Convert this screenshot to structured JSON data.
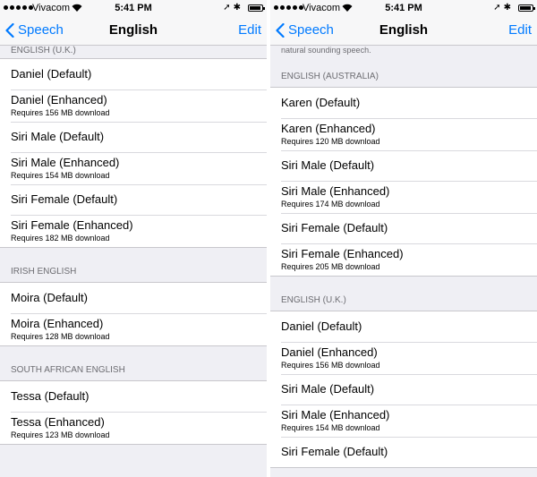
{
  "status": {
    "carrier": "Vivacom",
    "time": "5:41 PM",
    "battery_level": 0.9
  },
  "left": {
    "nav": {
      "back_label": "Speech",
      "title": "English",
      "edit_label": "Edit"
    },
    "sections": [
      {
        "header": "ENGLISH (U.K.)",
        "voices": [
          {
            "name": "Daniel (Default)",
            "detail": ""
          },
          {
            "name": "Daniel (Enhanced)",
            "detail": "Requires 156 MB download"
          },
          {
            "name": "Siri Male (Default)",
            "detail": ""
          },
          {
            "name": "Siri Male (Enhanced)",
            "detail": "Requires 154 MB download"
          },
          {
            "name": "Siri Female (Default)",
            "detail": ""
          },
          {
            "name": "Siri Female (Enhanced)",
            "detail": "Requires 182 MB download"
          }
        ]
      },
      {
        "header": "IRISH ENGLISH",
        "voices": [
          {
            "name": "Moira (Default)",
            "detail": ""
          },
          {
            "name": "Moira (Enhanced)",
            "detail": "Requires 128 MB download"
          }
        ]
      },
      {
        "header": "SOUTH AFRICAN ENGLISH",
        "voices": [
          {
            "name": "Tessa (Default)",
            "detail": ""
          },
          {
            "name": "Tessa (Enhanced)",
            "detail": "Requires 123 MB download"
          }
        ]
      }
    ]
  },
  "right": {
    "nav": {
      "back_label": "Speech",
      "title": "English",
      "edit_label": "Edit"
    },
    "intro_text": "natural sounding speech.",
    "sections": [
      {
        "header": "ENGLISH (AUSTRALIA)",
        "voices": [
          {
            "name": "Karen (Default)",
            "detail": ""
          },
          {
            "name": "Karen (Enhanced)",
            "detail": "Requires 120 MB download"
          },
          {
            "name": "Siri Male (Default)",
            "detail": ""
          },
          {
            "name": "Siri Male (Enhanced)",
            "detail": "Requires 174 MB download"
          },
          {
            "name": "Siri Female (Default)",
            "detail": ""
          },
          {
            "name": "Siri Female (Enhanced)",
            "detail": "Requires 205 MB download"
          }
        ]
      },
      {
        "header": "ENGLISH (U.K.)",
        "voices": [
          {
            "name": "Daniel (Default)",
            "detail": ""
          },
          {
            "name": "Daniel (Enhanced)",
            "detail": "Requires 156 MB download"
          },
          {
            "name": "Siri Male (Default)",
            "detail": ""
          },
          {
            "name": "Siri Male (Enhanced)",
            "detail": "Requires 154 MB download"
          },
          {
            "name": "Siri Female (Default)",
            "detail": ""
          }
        ]
      }
    ]
  }
}
